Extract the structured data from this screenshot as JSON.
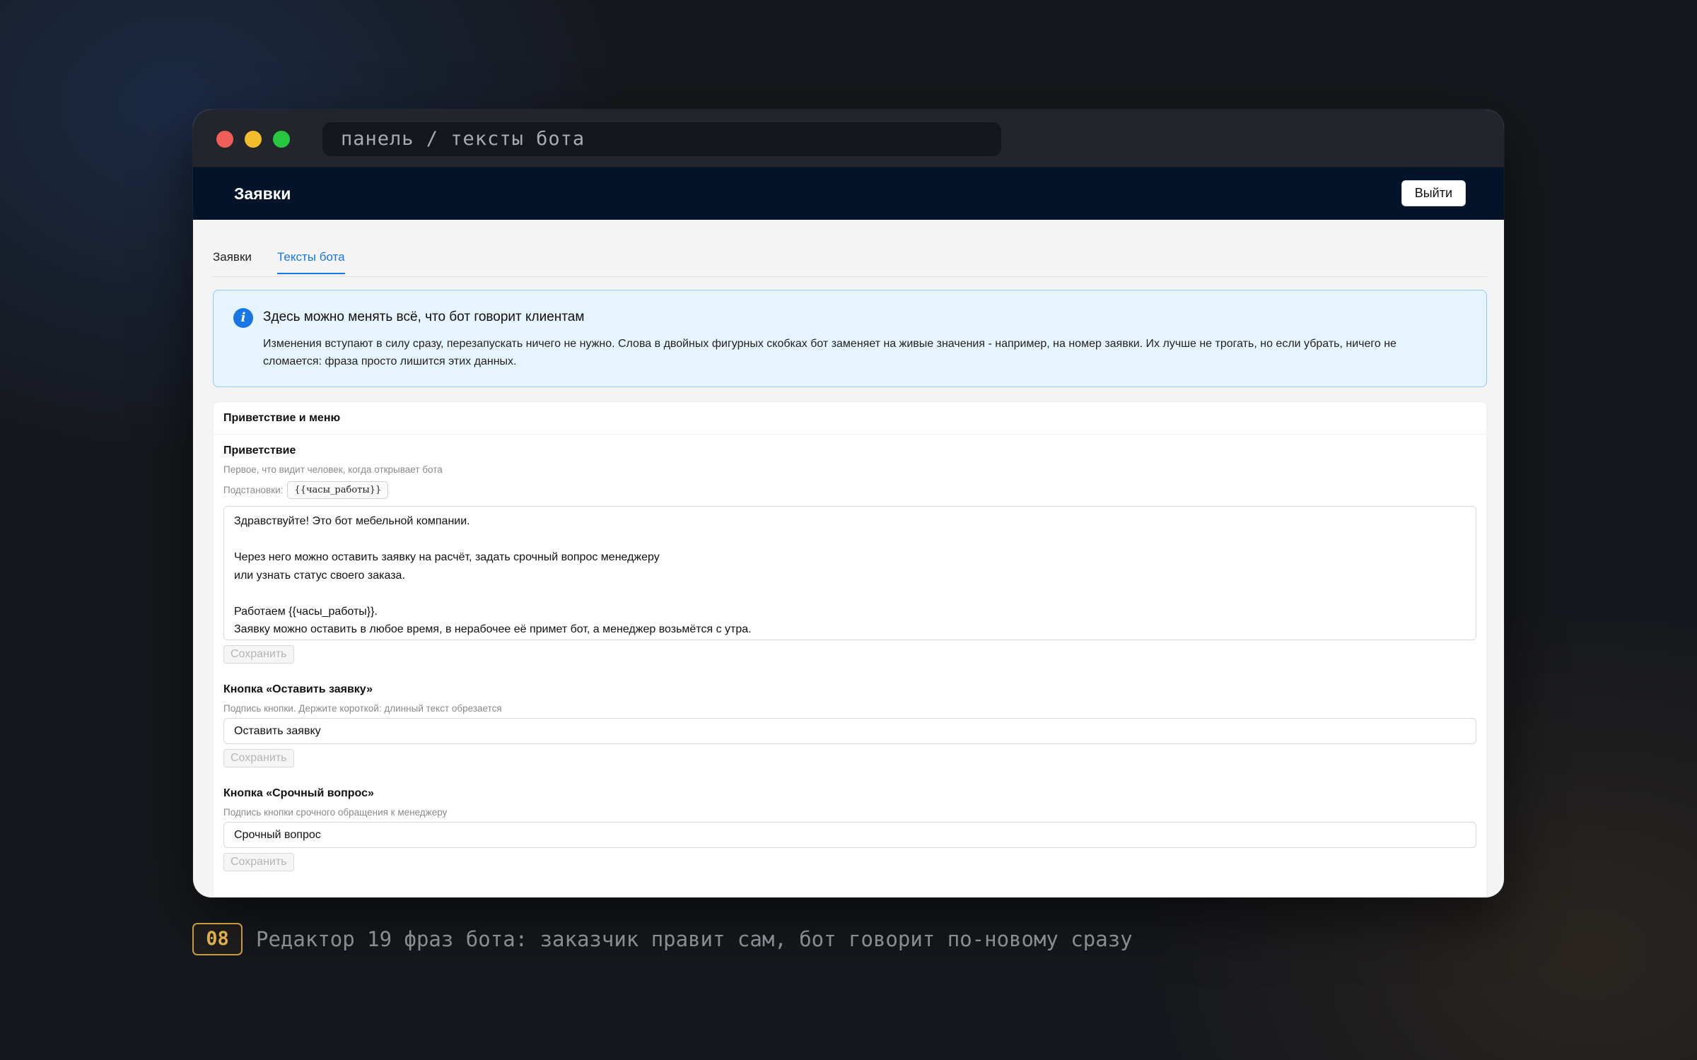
{
  "window": {
    "url": "панель / тексты бота"
  },
  "header": {
    "title": "Заявки",
    "logout_label": "Выйти"
  },
  "tabs": [
    {
      "label": "Заявки",
      "active": false
    },
    {
      "label": "Тексты бота",
      "active": true
    }
  ],
  "notice": {
    "title": "Здесь можно менять всё, что бот говорит клиентам",
    "text": "Изменения вступают в силу сразу, перезапускать ничего не нужно. Слова в двойных фигурных скобках бот заменяет на живые значения - например, на номер заявки. Их лучше не трогать, но если убрать, ничего не сломается: фраза просто лишится этих данных."
  },
  "section": {
    "title": "Приветствие и меню",
    "fields": [
      {
        "label": "Приветствие",
        "hint": "Первое, что видит человек, когда открывает бота",
        "subs_label": "Подстановки:",
        "subs": [
          "{{часы_работы}}"
        ],
        "lines": [
          "Здравствуйте! Это бот мебельной компании.",
          "",
          "Через него можно оставить заявку на расчёт, задать срочный вопрос менеджеру",
          "или узнать статус своего заказа.",
          "",
          "Работаем {{часы_работы}}.",
          "Заявку можно оставить в любое время, в нерабочее её примет бот, а менеджер возьмётся с утра."
        ],
        "save_label": "Сохранить"
      },
      {
        "label": "Кнопка «Оставить заявку»",
        "hint": "Подпись кнопки. Держите короткой: длинный текст обрезается",
        "value": "Оставить заявку",
        "save_label": "Сохранить"
      },
      {
        "label": "Кнопка «Срочный вопрос»",
        "hint": "Подпись кнопки срочного обращения к менеджеру",
        "value": "Срочный вопрос",
        "save_label": "Сохранить"
      }
    ]
  },
  "caption": {
    "badge": "08",
    "text": "Редактор 19 фраз бота: заказчик правит сам, бот говорит по-новому сразу"
  },
  "colors": {
    "accent": "#1677e5",
    "appbar": "#02132a",
    "notice_bg": "#e6f4ff",
    "badge": "#e0ad49"
  }
}
